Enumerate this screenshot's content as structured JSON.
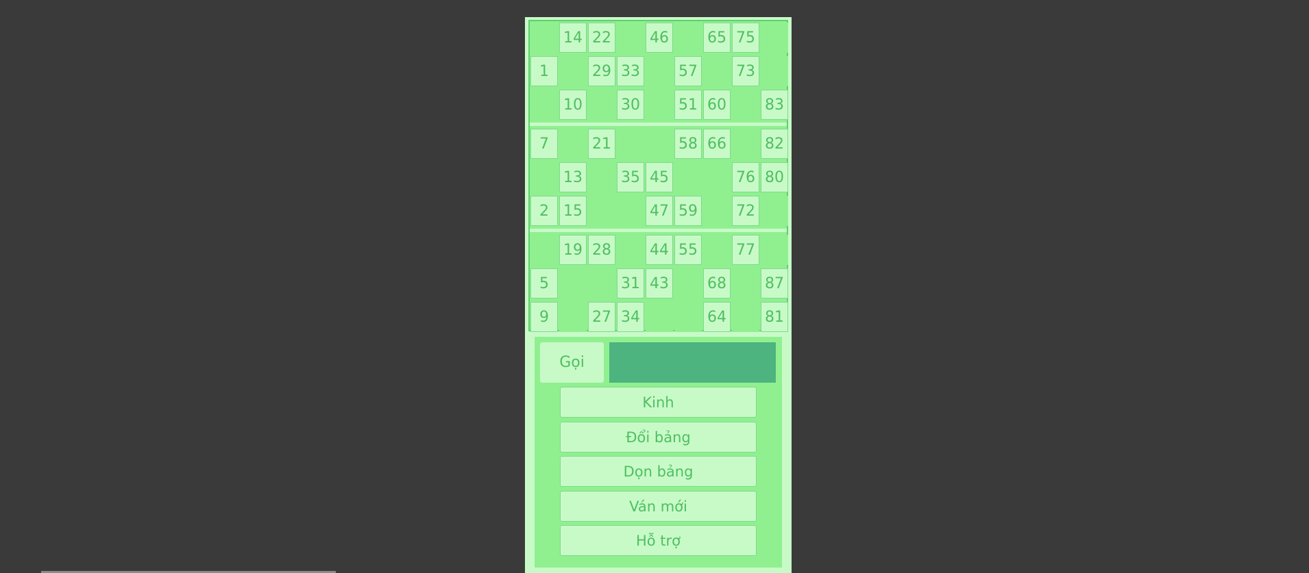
{
  "board": {
    "cards": [
      [
        [
          "",
          "14",
          "22",
          "",
          "46",
          "",
          "65",
          "75",
          ""
        ],
        [
          "1",
          "",
          "29",
          "33",
          "",
          "57",
          "",
          "73",
          ""
        ],
        [
          "",
          "10",
          "",
          "30",
          "",
          "51",
          "60",
          "",
          "83"
        ]
      ],
      [
        [
          "7",
          "",
          "21",
          "",
          "",
          "58",
          "66",
          "",
          "82"
        ],
        [
          "",
          "13",
          "",
          "35",
          "45",
          "",
          "",
          "76",
          "80"
        ],
        [
          "2",
          "15",
          "",
          "",
          "47",
          "59",
          "",
          "72",
          ""
        ]
      ],
      [
        [
          "",
          "19",
          "28",
          "",
          "44",
          "55",
          "",
          "77",
          ""
        ],
        [
          "5",
          "",
          "",
          "31",
          "43",
          "",
          "68",
          "",
          "87"
        ],
        [
          "9",
          "",
          "27",
          "34",
          "",
          "",
          "64",
          "",
          "81"
        ]
      ]
    ]
  },
  "controls": {
    "call_label": "Gọi",
    "call_value": "",
    "buttons": [
      {
        "name": "kinh-button",
        "label": "Kinh"
      },
      {
        "name": "change-board-button",
        "label": "Đổi bảng"
      },
      {
        "name": "clear-board-button",
        "label": "Dọn bảng"
      },
      {
        "name": "new-game-button",
        "label": "Ván mới"
      },
      {
        "name": "help-button",
        "label": "Hỗ trợ"
      }
    ]
  },
  "colors": {
    "page_background": "#3a3a3a",
    "panel_light": "#c8fac8",
    "panel_green": "#90f090",
    "text_green": "#4fbf60",
    "call_display": "#4db37f"
  }
}
